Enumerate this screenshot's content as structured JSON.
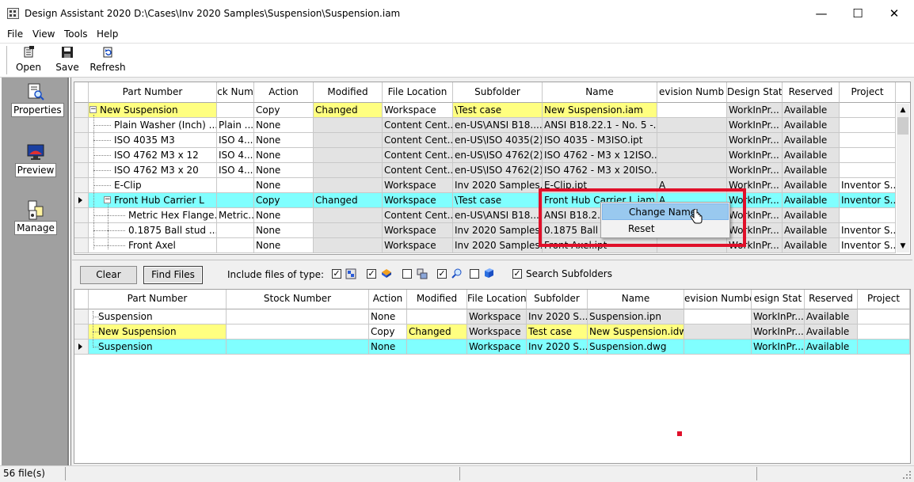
{
  "window": {
    "title": "Design Assistant 2020 D:\\Cases\\Inv 2020 Samples\\Suspension\\Suspension.iam",
    "minimize": "—",
    "maximize": "☐",
    "close": "✕"
  },
  "menu": [
    "File",
    "View",
    "Tools",
    "Help"
  ],
  "toolbar": {
    "open": "Open",
    "save": "Save",
    "refresh": "Refresh"
  },
  "left_panel": {
    "properties": "Properties",
    "preview": "Preview",
    "manage": "Manage"
  },
  "top_grid": {
    "columns": [
      "Part Number",
      "ck Num",
      "Action",
      "Modified",
      "File Location",
      "Subfolder",
      "Name",
      "evision Numb",
      "Design State",
      "Reserved",
      "Project"
    ],
    "sort_indicator": "△",
    "rows": [
      {
        "part": "New Suspension",
        "stock": "",
        "action": "Copy",
        "modified": "Changed",
        "location": "Workspace",
        "subfolder": "\\Test case",
        "name": "New Suspension.iam",
        "rev": "",
        "state": "WorkInPr...",
        "reserved": "Available",
        "project": ""
      },
      {
        "part": "Plain Washer (Inch) ...",
        "stock": "Plain ...",
        "action": "None",
        "modified": "",
        "location": "Content Cent...",
        "subfolder": "en-US\\ANSI B18....",
        "name": "ANSI B18.22.1 - No. 5 -...",
        "rev": "",
        "state": "WorkInPr...",
        "reserved": "Available",
        "project": ""
      },
      {
        "part": "ISO 4035 M3",
        "stock": "ISO 4...",
        "action": "None",
        "modified": "",
        "location": "Content Cent...",
        "subfolder": "en-US\\ISO 4035(2)",
        "name": "ISO 4035 - M3ISO.ipt",
        "rev": "",
        "state": "WorkInPr...",
        "reserved": "Available",
        "project": ""
      },
      {
        "part": "ISO 4762 M3 x 12",
        "stock": "ISO 4...",
        "action": "None",
        "modified": "",
        "location": "Content Cent...",
        "subfolder": "en-US\\ISO 4762(2)",
        "name": "ISO 4762 - M3 x 12ISO...",
        "rev": "",
        "state": "WorkInPr...",
        "reserved": "Available",
        "project": ""
      },
      {
        "part": "ISO 4762 M3 x 20",
        "stock": "ISO 4...",
        "action": "None",
        "modified": "",
        "location": "Content Cent...",
        "subfolder": "en-US\\ISO 4762(2)",
        "name": "ISO 4762 - M3 x 20ISO...",
        "rev": "",
        "state": "WorkInPr...",
        "reserved": "Available",
        "project": ""
      },
      {
        "part": "E-Clip",
        "stock": "",
        "action": "None",
        "modified": "",
        "location": "Workspace",
        "subfolder": "Inv 2020 Samples...",
        "name": "E-Clip.ipt",
        "rev": "A",
        "state": "WorkInPr...",
        "reserved": "Available",
        "project": "Inventor S..."
      },
      {
        "part": "Front Hub Carrier L",
        "stock": "",
        "action": "Copy",
        "modified": "Changed",
        "location": "Workspace",
        "subfolder": "\\Test case",
        "name": "Front Hub Carrier L.iam",
        "rev": "A",
        "state": "WorkInPr...",
        "reserved": "Available",
        "project": "Inventor S..."
      },
      {
        "part": "Metric Hex Flange...",
        "stock": "Metric...",
        "action": "None",
        "modified": "",
        "location": "Content Cent...",
        "subfolder": "en-US\\ANSI B18....",
        "name": "ANSI B18.2.4...",
        "rev": "",
        "state": "WorkInPr...",
        "reserved": "Available",
        "project": ""
      },
      {
        "part": "0.1875 Ball stud ....",
        "stock": "",
        "action": "None",
        "modified": "",
        "location": "Workspace",
        "subfolder": "Inv 2020 Samples...",
        "name": "0.1875 Ball st...",
        "rev": "",
        "state": "WorkInPr...",
        "reserved": "Available",
        "project": "Inventor S..."
      },
      {
        "part": "Front Axel",
        "stock": "",
        "action": "None",
        "modified": "",
        "location": "Workspace",
        "subfolder": "Inv 2020 Samples...",
        "name": "Front Axel.ipt",
        "rev": "",
        "state": "WorkInPr...",
        "reserved": "Available",
        "project": "Inventor S..."
      }
    ]
  },
  "context_menu": {
    "change_name": "Change Name",
    "reset": "Reset"
  },
  "filter_bar": {
    "clear": "Clear",
    "find_files": "Find Files",
    "include_label": "Include files of type:",
    "search_subfolders": "Search Subfolders"
  },
  "bottom_grid": {
    "columns": [
      "Part Number",
      "Stock Number",
      "Action",
      "Modified",
      "File Location",
      "Subfolder",
      "Name",
      "evision Numbe",
      "esign Stat",
      "Reserved",
      "Project"
    ],
    "rows": [
      {
        "part": "Suspension",
        "stock": "",
        "action": "None",
        "modified": "",
        "location": "Workspace",
        "subfolder": "Inv 2020 S...",
        "name": "Suspension.ipn",
        "rev": "",
        "state": "WorkInPr...",
        "reserved": "Available",
        "project": ""
      },
      {
        "part": "New Suspension",
        "stock": "",
        "action": "Copy",
        "modified": "Changed",
        "location": "Workspace",
        "subfolder": "Test case",
        "name": "New Suspension.idw",
        "rev": "",
        "state": "WorkInPr...",
        "reserved": "Available",
        "project": ""
      },
      {
        "part": "Suspension",
        "stock": "",
        "action": "None",
        "modified": "",
        "location": "Workspace",
        "subfolder": "Inv 2020 S...",
        "name": "Suspension.dwg",
        "rev": "",
        "state": "WorkInPr...",
        "reserved": "Available",
        "project": ""
      }
    ]
  },
  "status": {
    "file_count": "56 file(s)"
  },
  "colors": {
    "highlight_yellow": "#ffff80",
    "highlight_cyan": "#80ffff",
    "annotation_red": "#e0102a"
  }
}
